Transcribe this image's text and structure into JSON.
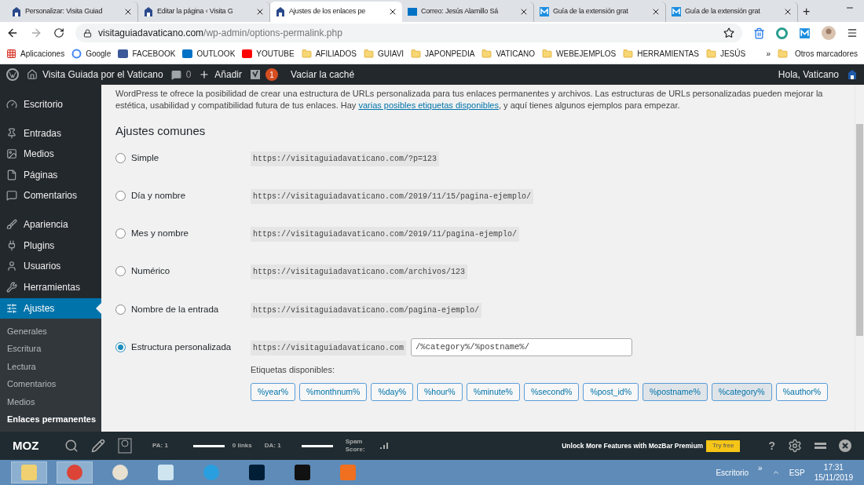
{
  "browser": {
    "tabs": [
      {
        "title": "Personalizar: Visita Guiad",
        "selected": false
      },
      {
        "title": "Editar la página ‹ Visita G",
        "selected": false
      },
      {
        "title": "Ajustes de los enlaces pe",
        "selected": true
      },
      {
        "title": "Correo: Jesús Alamillo Sá",
        "selected": false
      },
      {
        "title": "Guía de la extensión grat",
        "selected": false
      },
      {
        "title": "Guía de la extensión grat",
        "selected": false
      }
    ],
    "new_tab": "+",
    "url_host": "visitaguiadavaticano.com",
    "url_path": "/wp-admin/options-permalink.php",
    "bookmarks": [
      "Aplicaciones",
      "Google",
      "FACEBOOK",
      "OUTLOOK",
      "YOUTUBE",
      "AFILIADOS",
      "GUIAVI",
      "JAPONPEDIA",
      "VATICANO",
      "WEBEJEMPLOS",
      "HERRAMIENTAS",
      "JESÚS"
    ],
    "more": "»",
    "other_bookmarks": "Otros marcadores"
  },
  "admin_bar": {
    "site": "Visita Guiada por el Vaticano",
    "comments": "0",
    "new": "Añadir",
    "badge": "1",
    "cache": "Vaciar la caché",
    "greeting": "Hola, Vaticano"
  },
  "sidebar": {
    "items": [
      {
        "label": "Escritorio",
        "selected": false
      },
      {
        "label": "Entradas",
        "selected": false
      },
      {
        "label": "Medios",
        "selected": false
      },
      {
        "label": "Páginas",
        "selected": false
      },
      {
        "label": "Comentarios",
        "selected": false
      },
      {
        "label": "Apariencia",
        "selected": false
      },
      {
        "label": "Plugins",
        "selected": false
      },
      {
        "label": "Usuarios",
        "selected": false
      },
      {
        "label": "Herramientas",
        "selected": false
      },
      {
        "label": "Ajustes",
        "selected": true
      }
    ],
    "submenu": [
      {
        "label": "Generales",
        "selected": false
      },
      {
        "label": "Escritura",
        "selected": false
      },
      {
        "label": "Lectura",
        "selected": false
      },
      {
        "label": "Comentarios",
        "selected": false
      },
      {
        "label": "Medios",
        "selected": false
      },
      {
        "label": "Enlaces permanentes",
        "selected": true
      }
    ]
  },
  "content": {
    "intro_before": "WordPress te ofrece la posibilidad de crear una estructura de URLs personalizada para tus enlaces permanentes y archivos. Las estructuras de URLs personalizadas pueden mejorar la estética, usabilidad y compatibilidad futura de tus enlaces. Hay",
    "intro_link": "varias posibles etiquetas disponibles",
    "intro_after": ", y aquí tienes algunos ejemplos para empezar.",
    "heading": "Ajustes comunes",
    "options": [
      {
        "label": "Simple",
        "example": "https://visitaguiadavaticano.com/?p=123",
        "selected": false
      },
      {
        "label": "Día y nombre",
        "example": "https://visitaguiadavaticano.com/2019/11/15/pagina-ejemplo/",
        "selected": false
      },
      {
        "label": "Mes y nombre",
        "example": "https://visitaguiadavaticano.com/2019/11/pagina-ejemplo/",
        "selected": false
      },
      {
        "label": "Numérico",
        "example": "https://visitaguiadavaticano.com/archivos/123",
        "selected": false
      },
      {
        "label": "Nombre de la entrada",
        "example": "https://visitaguiadavaticano.com/pagina-ejemplo/",
        "selected": false
      },
      {
        "label": "Estructura personalizada",
        "example": "https://visitaguiadavaticano.com",
        "value": "/%category%/%postname%/",
        "selected": true
      }
    ],
    "tags_label": "Etiquetas disponibles:",
    "tags": [
      {
        "label": "%year%",
        "selected": false
      },
      {
        "label": "%monthnum%",
        "selected": false
      },
      {
        "label": "%day%",
        "selected": false
      },
      {
        "label": "%hour%",
        "selected": false
      },
      {
        "label": "%minute%",
        "selected": false
      },
      {
        "label": "%second%",
        "selected": false
      },
      {
        "label": "%post_id%",
        "selected": false
      },
      {
        "label": "%postname%",
        "selected": true
      },
      {
        "label": "%category%",
        "selected": true
      },
      {
        "label": "%author%",
        "selected": false
      }
    ]
  },
  "mozbar": {
    "logo": "MOZ",
    "pa": "PA: 1",
    "links": "0 links",
    "da": "DA: 1",
    "spam": "Spam Score:",
    "promo": "Unlock More Features with MozBar Premium",
    "try": "Try free",
    "help": "?"
  },
  "taskbar": {
    "desktop": "Escritorio",
    "more": "»",
    "lang": "ESP",
    "time": "17:31",
    "date": "15/11/2019"
  }
}
